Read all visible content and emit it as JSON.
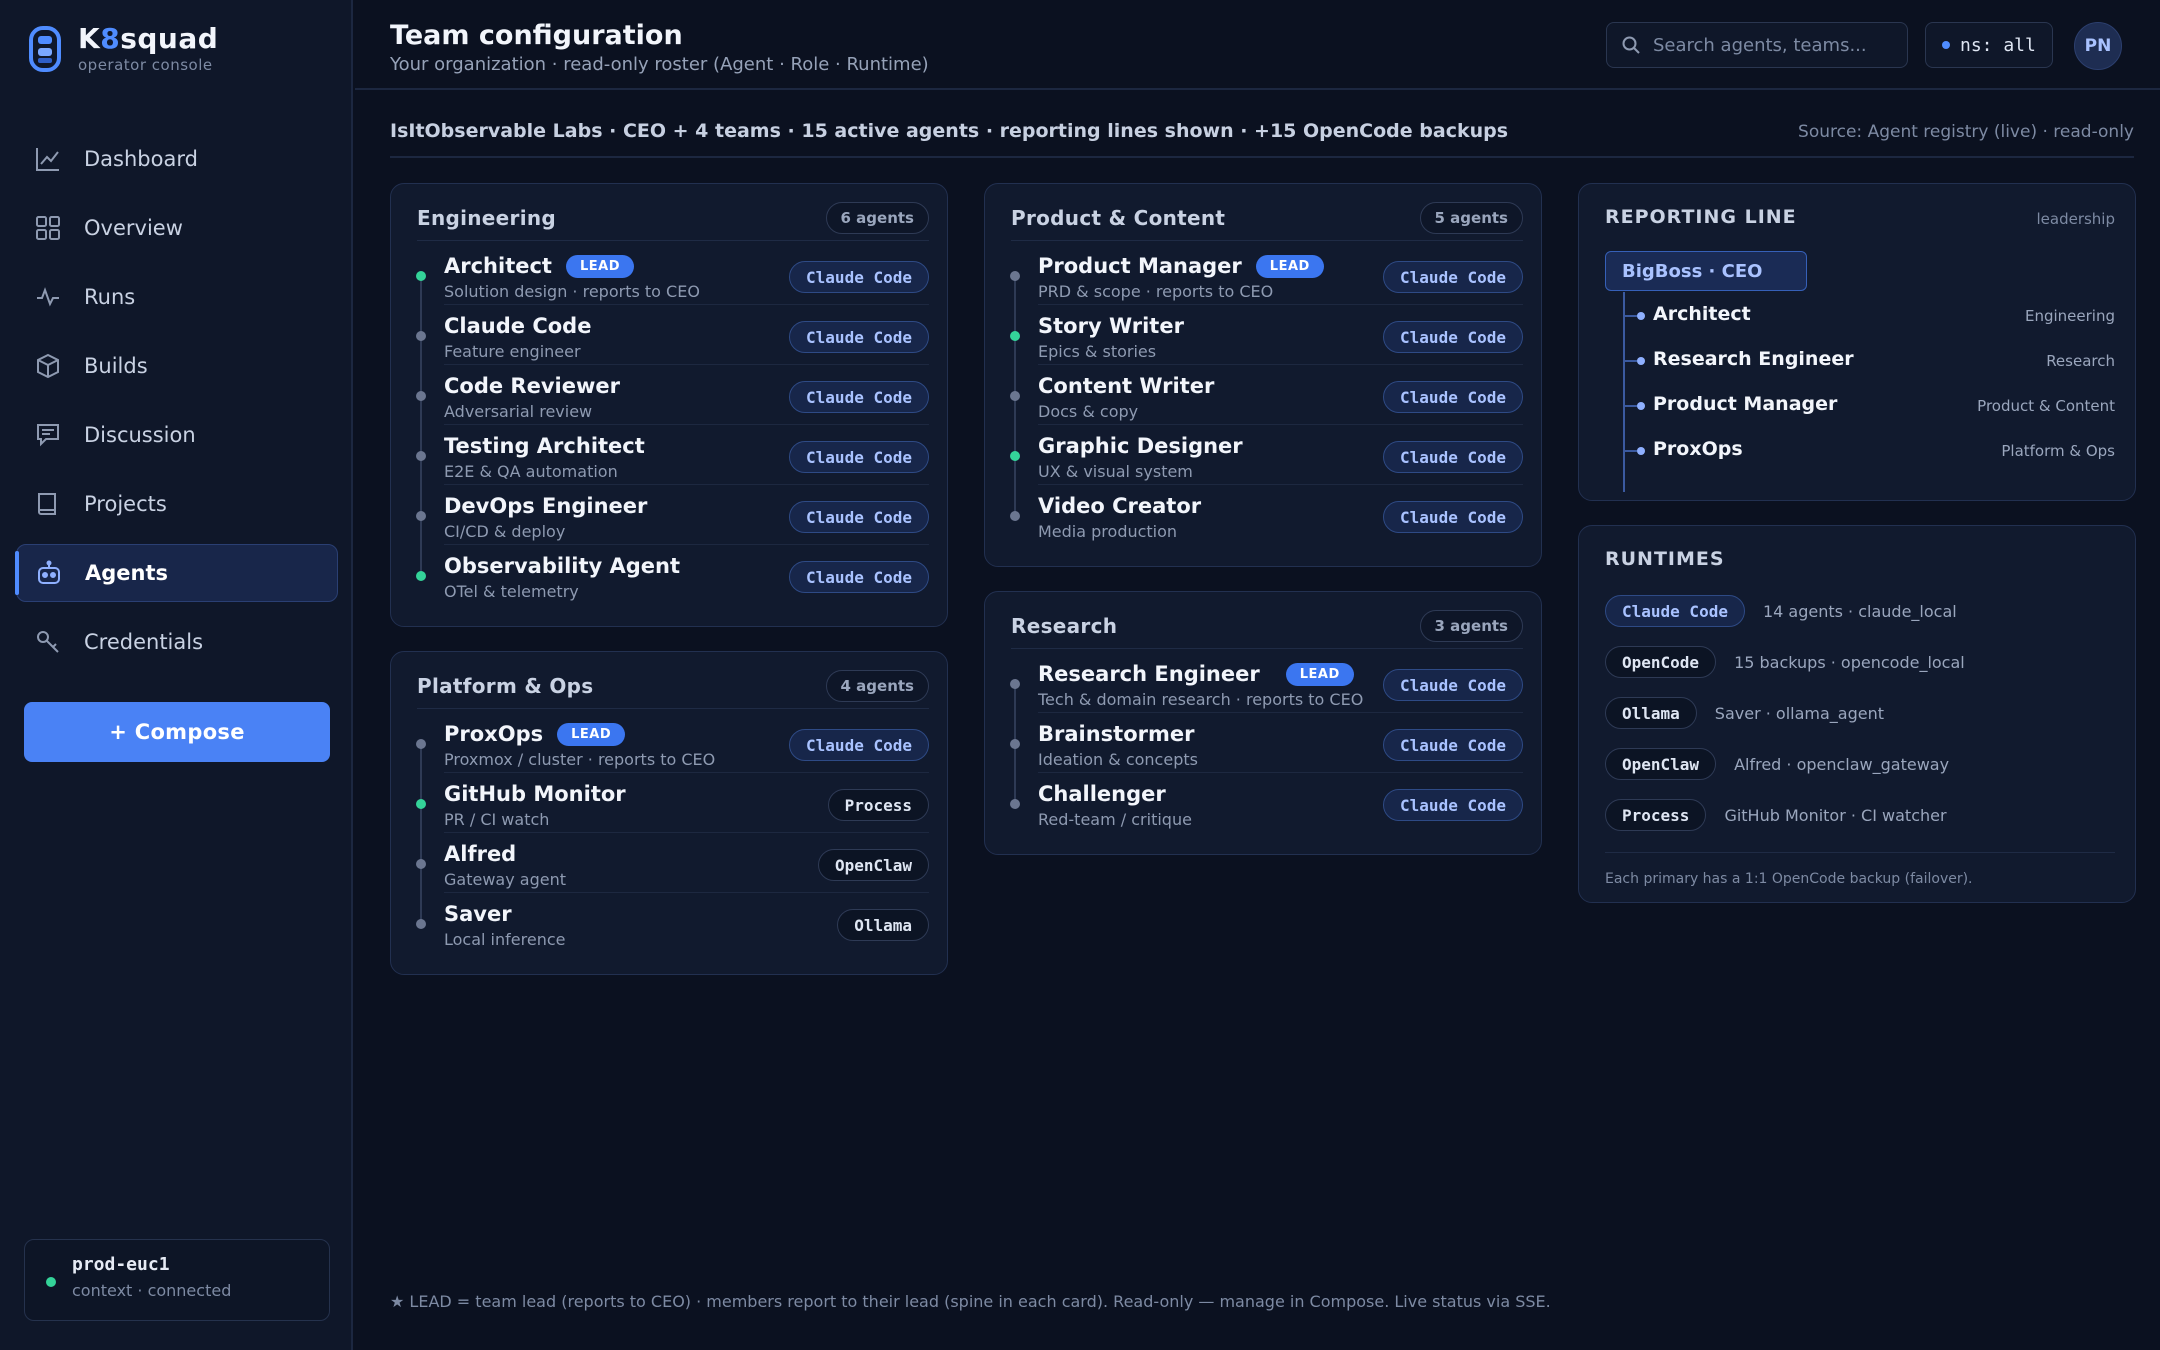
{
  "brand": {
    "name_prefix": "K",
    "name_accent": "8",
    "name_suffix": "squad",
    "subtitle": "operator console"
  },
  "nav": {
    "items": [
      {
        "label": "Dashboard",
        "icon": "chart-line-icon"
      },
      {
        "label": "Overview",
        "icon": "grid-icon"
      },
      {
        "label": "Runs",
        "icon": "pulse-icon"
      },
      {
        "label": "Builds",
        "icon": "box-icon"
      },
      {
        "label": "Discussion",
        "icon": "chat-icon"
      },
      {
        "label": "Projects",
        "icon": "book-icon"
      },
      {
        "label": "Agents",
        "icon": "robot-icon",
        "active": true
      },
      {
        "label": "Credentials",
        "icon": "key-icon"
      }
    ],
    "compose_label": "+ Compose"
  },
  "context": {
    "name": "prod-euc1",
    "status": "context · connected"
  },
  "header": {
    "title": "Team configuration",
    "subtitle": "Your organization · read-only roster (Agent · Role · Runtime)",
    "search_placeholder": "Search agents, teams...",
    "namespace": "ns: all",
    "avatar_initials": "PN"
  },
  "summary": {
    "text": "IsItObservable Labs · CEO + 4 teams · 15 active agents · reporting lines shown · +15 OpenCode backups",
    "source": "Source: Agent registry (live) · read-only"
  },
  "teams": {
    "engineering": {
      "title": "Engineering",
      "count": "6 agents",
      "members": [
        {
          "name": "Architect",
          "role": "Solution design · reports to CEO",
          "lead": "LEAD",
          "runtime": "Claude Code",
          "online": true
        },
        {
          "name": "Claude Code",
          "role": "Feature engineer",
          "runtime": "Claude Code",
          "online": false
        },
        {
          "name": "Code Reviewer",
          "role": "Adversarial review",
          "runtime": "Claude Code",
          "online": false
        },
        {
          "name": "Testing Architect",
          "role": "E2E & QA automation",
          "runtime": "Claude Code",
          "online": false
        },
        {
          "name": "DevOps Engineer",
          "role": "CI/CD & deploy",
          "runtime": "Claude Code",
          "online": false
        },
        {
          "name": "Observability Agent",
          "role": "OTel & telemetry",
          "runtime": "Claude Code",
          "online": true
        }
      ]
    },
    "platform": {
      "title": "Platform & Ops",
      "count": "4 agents",
      "members": [
        {
          "name": "ProxOps",
          "role": "Proxmox / cluster · reports to CEO",
          "lead": "LEAD",
          "runtime": "Claude Code",
          "online": false
        },
        {
          "name": "GitHub Monitor",
          "role": "PR / CI watch",
          "runtime": "Process",
          "online": true
        },
        {
          "name": "Alfred",
          "role": "Gateway agent",
          "runtime": "OpenClaw",
          "online": false
        },
        {
          "name": "Saver",
          "role": "Local inference",
          "runtime": "Ollama",
          "online": false
        }
      ]
    },
    "product": {
      "title": "Product & Content",
      "count": "5 agents",
      "members": [
        {
          "name": "Product Manager",
          "role": "PRD & scope · reports to CEO",
          "lead": "LEAD",
          "runtime": "Claude Code",
          "online": false
        },
        {
          "name": "Story Writer",
          "role": "Epics & stories",
          "runtime": "Claude Code",
          "online": true
        },
        {
          "name": "Content Writer",
          "role": "Docs & copy",
          "runtime": "Claude Code",
          "online": false
        },
        {
          "name": "Graphic Designer",
          "role": "UX & visual system",
          "runtime": "Claude Code",
          "online": true
        },
        {
          "name": "Video Creator",
          "role": "Media production",
          "runtime": "Claude Code",
          "online": false
        }
      ]
    },
    "research": {
      "title": "Research",
      "count": "3 agents",
      "members": [
        {
          "name": "Research Engineer",
          "role": "Tech & domain research · reports to CEO",
          "lead": "LEAD",
          "runtime": "Claude Code",
          "online": false
        },
        {
          "name": "Brainstormer",
          "role": "Ideation & concepts",
          "runtime": "Claude Code",
          "online": false
        },
        {
          "name": "Challenger",
          "role": "Red-team / critique",
          "runtime": "Claude Code",
          "online": false
        }
      ]
    }
  },
  "reporting_line": {
    "title": "REPORTING LINE",
    "tag": "leadership",
    "ceo": "BigBoss · CEO",
    "reports": [
      {
        "name": "Architect",
        "team": "Engineering"
      },
      {
        "name": "Research Engineer",
        "team": "Research"
      },
      {
        "name": "Product Manager",
        "team": "Product & Content"
      },
      {
        "name": "ProxOps",
        "team": "Platform & Ops"
      }
    ]
  },
  "runtimes": {
    "title": "RUNTIMES",
    "items": [
      {
        "name": "Claude Code",
        "desc": "14 agents · claude_local",
        "style": "claude"
      },
      {
        "name": "OpenCode",
        "desc": "15 backups · opencode_local",
        "style": "plain"
      },
      {
        "name": "Ollama",
        "desc": "Saver · ollama_agent",
        "style": "plain"
      },
      {
        "name": "OpenClaw",
        "desc": "Alfred · openclaw_gateway",
        "style": "plain"
      },
      {
        "name": "Process",
        "desc": "GitHub Monitor · CI watcher",
        "style": "plain"
      }
    ],
    "footer": "Each primary has a 1:1 OpenCode backup (failover)."
  },
  "footer_note": "★ LEAD = team lead (reports to CEO) · members report to their lead (spine in each card). Read-only — manage in Compose. Live status via SSE.",
  "colors": {
    "accent": "#4f8cff",
    "online": "#34d399",
    "background": "#0b1120"
  }
}
